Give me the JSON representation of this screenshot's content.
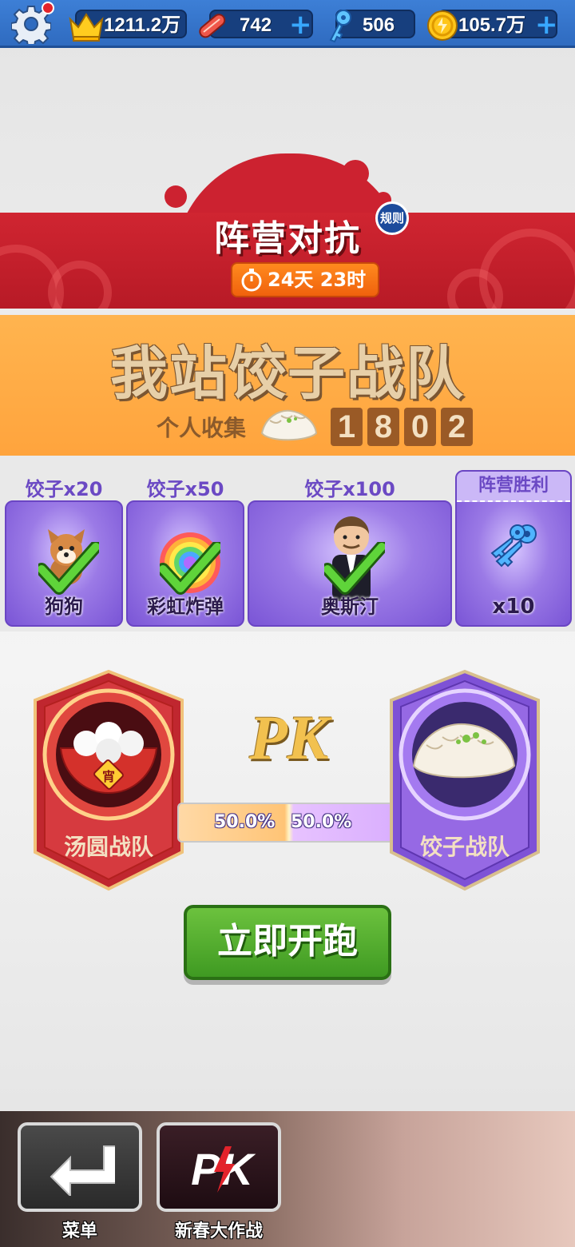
{
  "resources": {
    "crowns": "1211.2万",
    "boards": "742",
    "keys": "506",
    "coins": "105.7万"
  },
  "event": {
    "title": "阵营对抗",
    "rules_label": "规则",
    "timer": "24天 23时"
  },
  "team": {
    "banner_title": "我站饺子战队",
    "collect_label": "个人收集",
    "collect_digits": [
      "1",
      "8",
      "0",
      "2"
    ]
  },
  "rewards": [
    {
      "requirement": "饺子x20",
      "name": "狗狗",
      "claimed": true
    },
    {
      "requirement": "饺子x50",
      "name": "彩虹炸弹",
      "claimed": true
    },
    {
      "requirement": "饺子x100",
      "name": "奥斯汀",
      "claimed": true
    }
  ],
  "victory_reward": {
    "header": "阵营胜利",
    "quantity": "x10"
  },
  "pk": {
    "title": "PK",
    "left_percent": "50.0%",
    "right_percent": "50.0%",
    "left_team": "汤圆战队",
    "right_team": "饺子战队",
    "bowl_tag": "宵"
  },
  "actions": {
    "run_label": "立即开跑"
  },
  "nav": {
    "menu_label": "菜单",
    "event_label": "新春大作战",
    "event_icon_text": "PK"
  },
  "colors": {
    "accent_red": "#cc2230",
    "accent_orange": "#ffa43d",
    "accent_purple": "#7a55d6",
    "button_green": "#4fa82a"
  }
}
